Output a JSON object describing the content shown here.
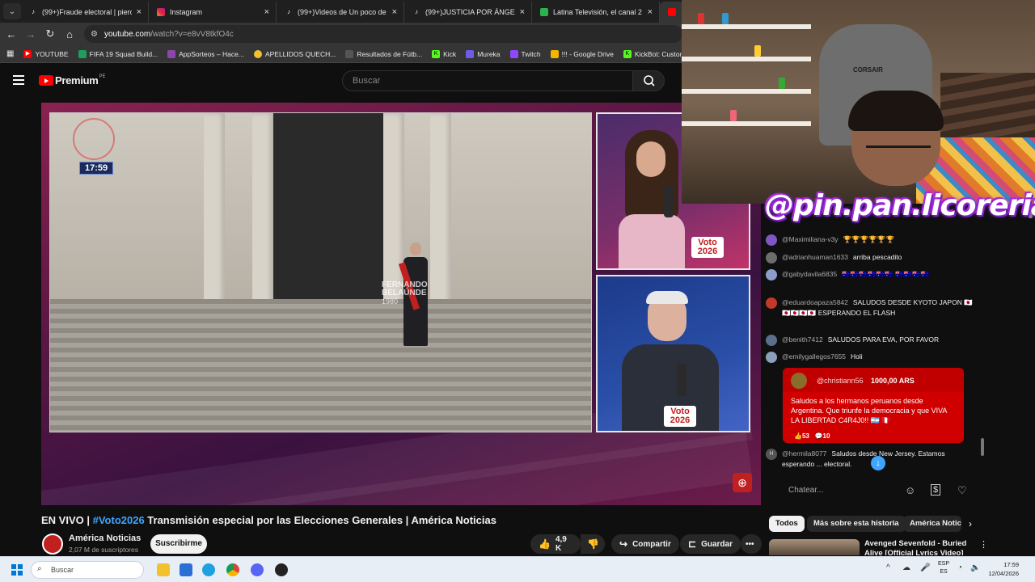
{
  "browser": {
    "tabs": [
      {
        "title": "(99+)Fraude electoral | piero co",
        "fav": "tiktok"
      },
      {
        "title": "Instagram",
        "fav": "instagram"
      },
      {
        "title": "(99+)Videos de Un poco de to",
        "fav": "tiktok"
      },
      {
        "title": "(99+)JUSTICIA POR ÁNGEL 🙏",
        "fav": "tiktok"
      },
      {
        "title": "Latina Televisión, el canal 2 de",
        "fav": "latina"
      }
    ],
    "active_tab_letter": "E",
    "url_host": "youtube.com",
    "url_path": "/watch?v=e8vV8tkfO4c",
    "bookmarks": [
      "YOUTUBE",
      "FIFA 19 Squad Build...",
      "AppSorteos – Hace...",
      "APELLIDOS QUECH...",
      "Resultados de Fútb...",
      "Kick",
      "Mureka",
      "Twitch",
      "!!! - Google Drive",
      "KickBot: Customiza..."
    ]
  },
  "youtube": {
    "brand": "Premium",
    "country": "PE",
    "search_placeholder": "Buscar"
  },
  "video": {
    "clock": "17:59",
    "lower_third_name": "FERNANDO BELAÚNDE",
    "lower_third_year": "1980",
    "badge_text": "Voto",
    "badge_year": "2026",
    "title_prefix": "EN VIVO | ",
    "title_tag": "#Voto2026",
    "title_rest": " Transmisión especial por las Elecciones Generales | América Noticias"
  },
  "channel": {
    "name": "América Noticias",
    "subs": "2,07 M de suscriptores",
    "subscribe": "Suscribirme",
    "likes": "4,9 K",
    "share": "Compartir",
    "save": "Guardar"
  },
  "webcam": {
    "chair_brand": "CORSAIR",
    "watermark": "@pin.pan.licoreria"
  },
  "chat": {
    "messages": [
      {
        "user": "@Maximiliana-v3y",
        "text": "🏆🏆🏆🏆🏆🏆",
        "color": "#7e57c2"
      },
      {
        "user": "@adrianhuaman1633",
        "text": "arriba pescadito",
        "color": "#6d6d6d"
      },
      {
        "user": "@gabydavila6835",
        "text": "🇦🇺🇦🇺🇦🇺🇦🇺🇦🇺🇦🇺 🇦🇺🇦🇺🇦🇺🇦🇺",
        "color": "#8e9cc9"
      },
      {
        "user": "@eduardoapaza5842",
        "text": "SALUDOS DESDE KYOTO JAPON 🇯🇵🇯🇵🇯🇵🇯🇵🇯🇵 ESPERANDO EL FLASH",
        "color": "#c0392b"
      },
      {
        "user": "@benith7412",
        "text": "SALUDOS PARA EVA, POR FAVOR",
        "color": "#5b6f8a"
      },
      {
        "user": "@emilygallegos7655",
        "text": "Holi",
        "color": "#8aa0b8"
      }
    ],
    "superchat": {
      "user": "@christiann56",
      "amount": "1000,00 ARS",
      "text": "Saludos a los hermanos peruanos desde Argentina. Que triunfe la democracia y que VIVA LA LIBERTAD C4R4J0!! 🇦🇷 🇵🇪",
      "likes": "53",
      "replies": "10"
    },
    "last": {
      "user": "@hermila8077",
      "text": "Saludos desde New Jersey. Estamos esperando ... electoral."
    },
    "input_placeholder": "Chatear..."
  },
  "suggestions": {
    "chips": [
      "Todos",
      "Más sobre esta historia",
      "América Notic"
    ],
    "video_title": "Avenged Sevenfold - Buried Alive [Official Lyrics Video]"
  },
  "taskbar": {
    "search": "Buscar",
    "lang_top": "ESP",
    "lang_bottom": "ES",
    "time": "17:59",
    "date": "12/04/2026"
  }
}
